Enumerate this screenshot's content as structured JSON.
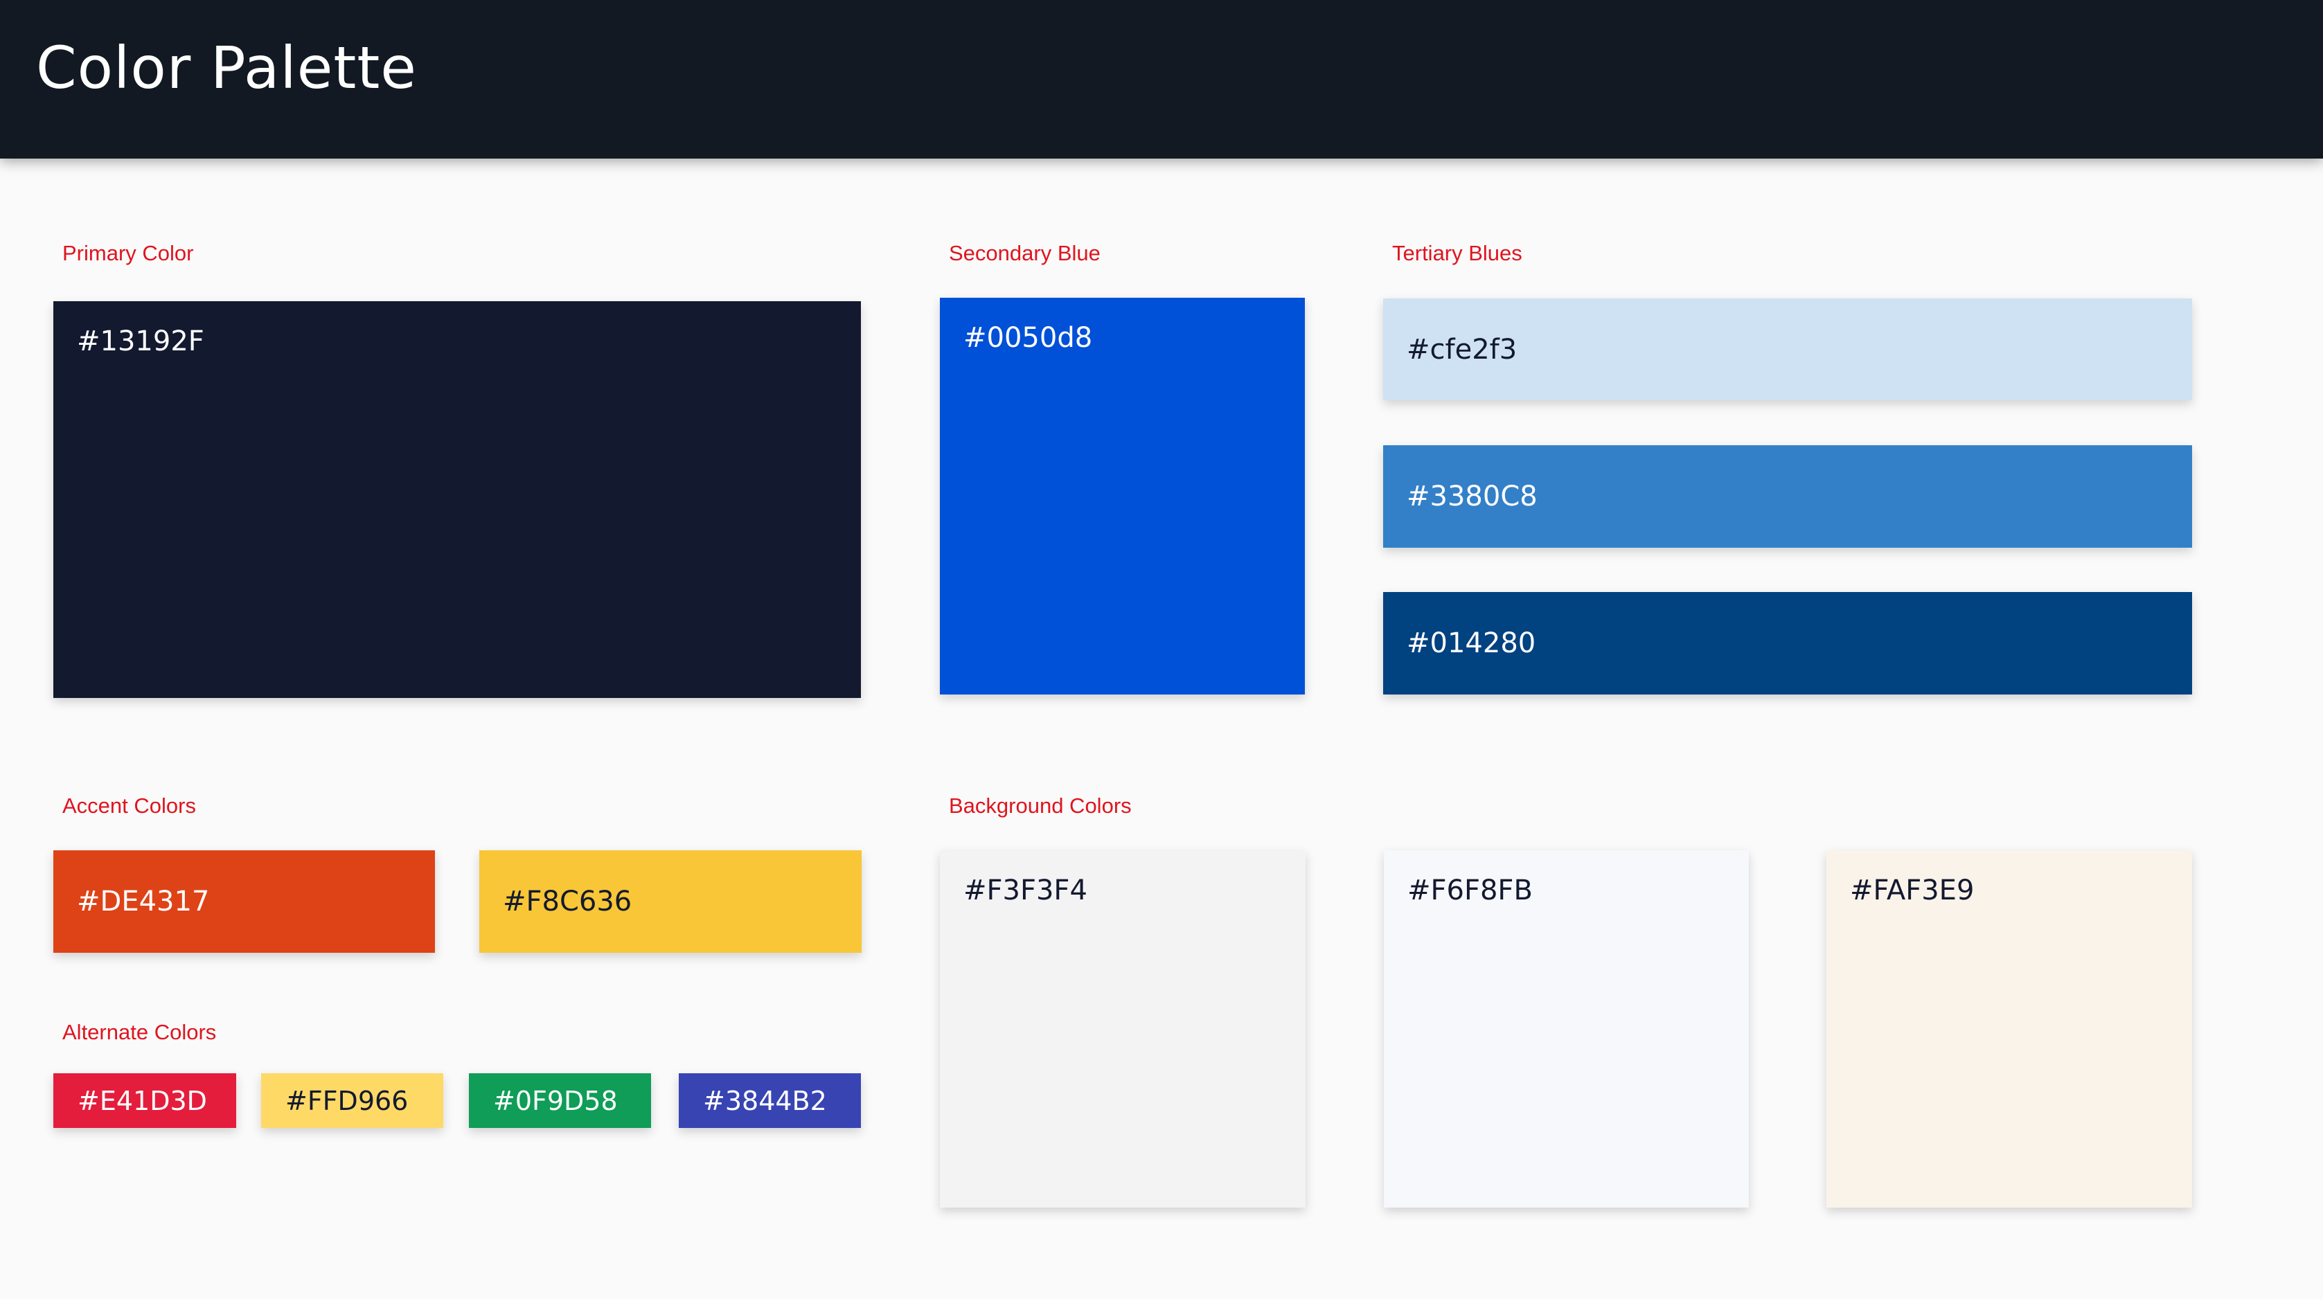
{
  "header": {
    "title": "Color Palette",
    "background": "#121923"
  },
  "label_color": "#e0141e",
  "sections": {
    "primary": {
      "label": "Primary Color",
      "swatches": [
        {
          "code": "#13192F",
          "color": "#13192F",
          "text_color": "#ffffff"
        }
      ]
    },
    "secondary": {
      "label": "Secondary Blue",
      "swatches": [
        {
          "code": "#0050d8",
          "color": "#0050d8",
          "text_color": "#ffffff"
        }
      ]
    },
    "tertiary": {
      "label": "Tertiary Blues",
      "swatches": [
        {
          "code": "#cfe2f3",
          "color": "#cfe2f3",
          "text_color": "#13192F"
        },
        {
          "code": "#3380C8",
          "color": "#3380C8",
          "text_color": "#ffffff"
        },
        {
          "code": "#014280",
          "color": "#014280",
          "text_color": "#ffffff"
        }
      ]
    },
    "accent": {
      "label": "Accent Colors",
      "swatches": [
        {
          "code": "#DE4317",
          "color": "#DE4317",
          "text_color": "#ffffff"
        },
        {
          "code": "#F8C636",
          "color": "#F8C636",
          "text_color": "#13192F"
        }
      ]
    },
    "alternate": {
      "label": "Alternate Colors",
      "swatches": [
        {
          "code": "#E41D3D",
          "color": "#E41D3D",
          "text_color": "#ffffff"
        },
        {
          "code": "#FFD966",
          "color": "#FFD966",
          "text_color": "#13192F"
        },
        {
          "code": "#0F9D58",
          "color": "#0F9D58",
          "text_color": "#ffffff"
        },
        {
          "code": "#3844B2",
          "color": "#3844B2",
          "text_color": "#ffffff"
        }
      ]
    },
    "background": {
      "label": "Background Colors",
      "swatches": [
        {
          "code": "#F3F3F4",
          "color": "#F3F3F4",
          "text_color": "#13192F"
        },
        {
          "code": "#F6F8FB",
          "color": "#F6F8FB",
          "text_color": "#13192F"
        },
        {
          "code": "#FAF3E9",
          "color": "#FAF3E9",
          "text_color": "#13192F"
        }
      ]
    }
  }
}
